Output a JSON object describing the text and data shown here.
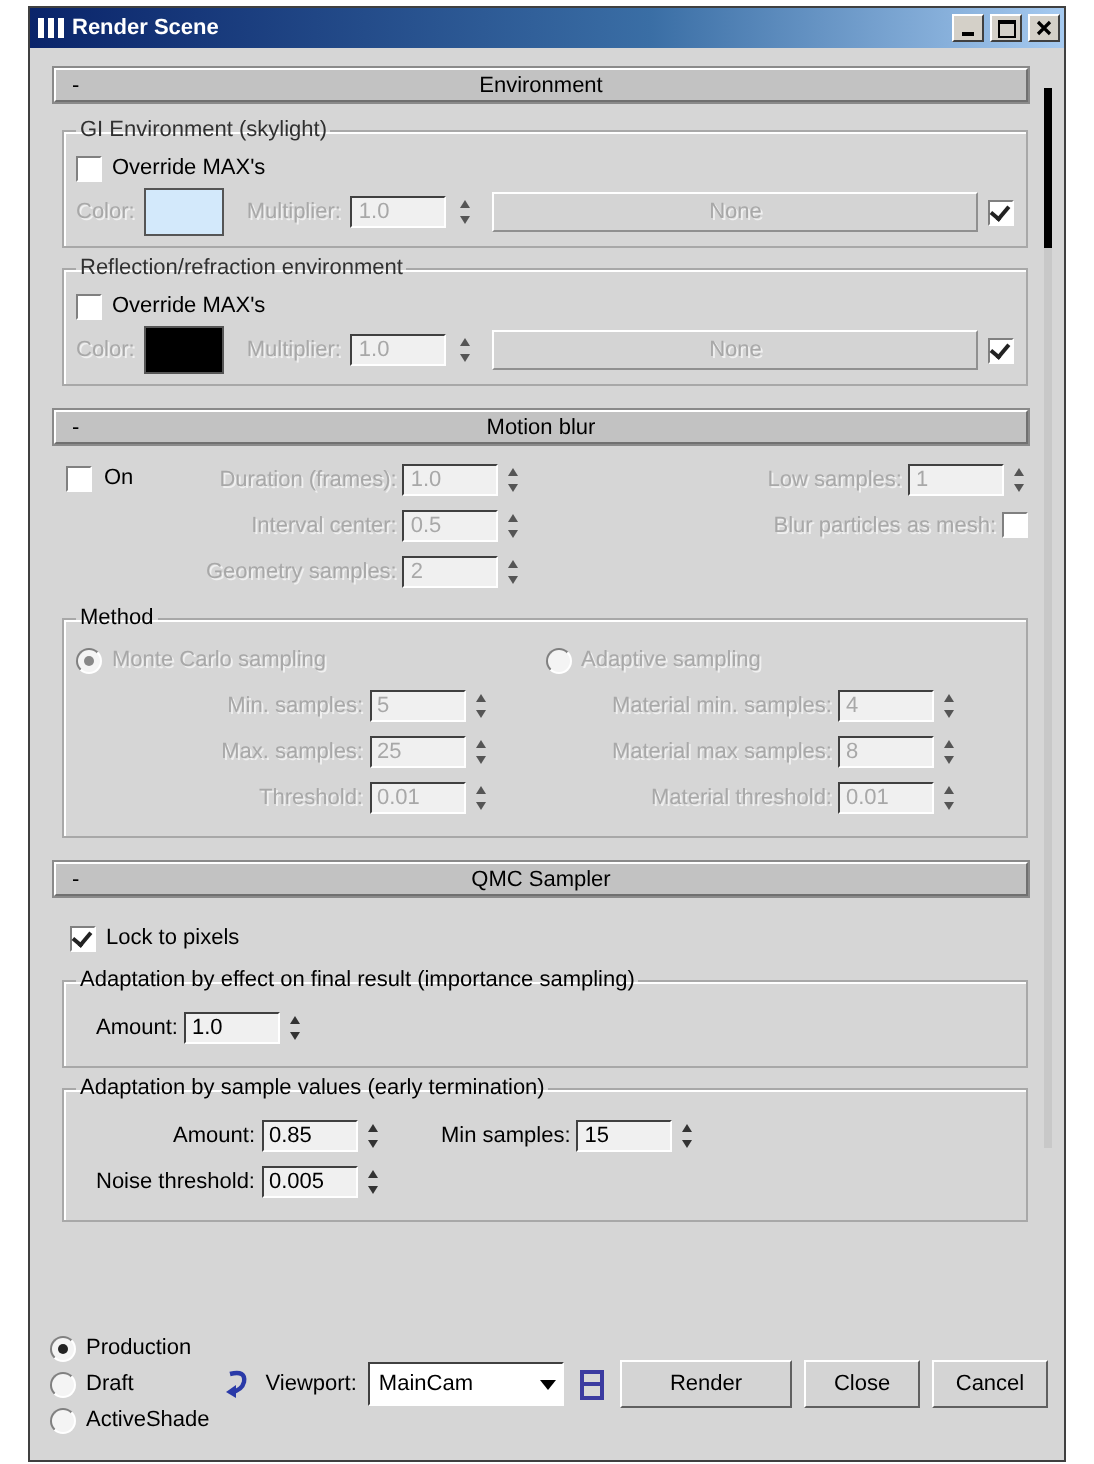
{
  "window": {
    "title": "Render Scene"
  },
  "environment": {
    "title": "Environment",
    "toggle": "-",
    "groups": [
      {
        "title": "GI Environment (skylight)",
        "disabled": true,
        "override": {
          "label": "Override MAX's",
          "checked": false
        },
        "color_label": "Color:",
        "color": "#d3e9fb",
        "multiplier_label": "Multiplier:",
        "multiplier": "1.0",
        "map": "None",
        "map_on": true
      },
      {
        "title": "Reflection/refraction environment",
        "disabled": true,
        "override": {
          "label": "Override MAX's",
          "checked": false
        },
        "color_label": "Color:",
        "color": "#000000",
        "multiplier_label": "Multiplier:",
        "multiplier": "1.0",
        "map": "None",
        "map_on": true
      }
    ]
  },
  "motion_blur": {
    "title": "Motion blur",
    "toggle": "-",
    "on": {
      "label": "On",
      "checked": false
    },
    "disabled": true,
    "left": [
      {
        "label": "Duration (frames):",
        "value": "1.0"
      },
      {
        "label": "Interval center:",
        "value": "0.5"
      },
      {
        "label": "Geometry samples:",
        "value": "2"
      }
    ],
    "right": [
      {
        "kind": "spinner",
        "label": "Low samples:",
        "value": "1"
      },
      {
        "kind": "checkbox",
        "label": "Blur particles as mesh:",
        "checked": false
      }
    ],
    "method": {
      "title": "Method",
      "options": [
        {
          "label": "Monte Carlo sampling",
          "selected": true,
          "fields": [
            {
              "label": "Min. samples:",
              "value": "5"
            },
            {
              "label": "Max. samples:",
              "value": "25"
            },
            {
              "label": "Threshold:",
              "value": "0.01"
            }
          ]
        },
        {
          "label": "Adaptive sampling",
          "selected": false,
          "fields": [
            {
              "label": "Material min. samples:",
              "value": "4"
            },
            {
              "label": "Material max samples:",
              "value": "8"
            },
            {
              "label": "Material threshold:",
              "value": "0.01"
            }
          ]
        }
      ]
    }
  },
  "qmc": {
    "title": "QMC Sampler",
    "toggle": "-",
    "lock": {
      "label": "Lock to pixels",
      "checked": true
    },
    "groups": [
      {
        "title": "Adaptation by effect on final result (importance sampling)",
        "fields": [
          {
            "label": "Amount:",
            "value": "1.0"
          }
        ]
      },
      {
        "title": "Adaptation by sample values (early termination)",
        "fields": [
          {
            "label": "Amount:",
            "value": "0.85"
          },
          {
            "label": "Min samples:",
            "value": "15"
          },
          {
            "label": "Noise threshold:",
            "value": "0.005"
          }
        ]
      }
    ]
  },
  "footer": {
    "modes": [
      {
        "label": "Production",
        "selected": true
      },
      {
        "label": "Draft",
        "selected": false
      },
      {
        "label": "ActiveShade",
        "selected": false
      }
    ],
    "viewport_label": "Viewport:",
    "viewport": "MainCam",
    "buttons": [
      "Render",
      "Close",
      "Cancel"
    ]
  }
}
